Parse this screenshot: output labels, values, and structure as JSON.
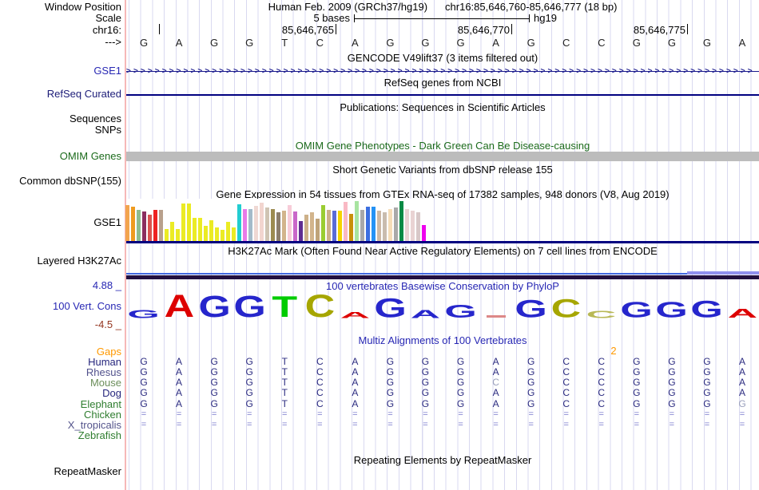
{
  "header": {
    "window_position_label": "Window Position",
    "assembly_line": "Human Feb. 2009 (GRCh37/hg19)",
    "position_line": "chr16:85,646,760-85,646,777 (18 bp)",
    "scale_label": "Scale",
    "scale_value": "5 bases",
    "assembly_short": "hg19",
    "chrom_label": "chr16:",
    "ruler": [
      {
        "text": "",
        "tick_x": 199
      },
      {
        "text": "85,646,765",
        "tick_x": 420
      },
      {
        "text": "85,646,770",
        "tick_x": 640
      },
      {
        "text": "85,646,775",
        "tick_x": 860
      }
    ],
    "strand_label": "--->",
    "sequence": "GAGGTCAGGGAGCCGGGA"
  },
  "tracks": {
    "gencode": {
      "title": "GENCODE V49lift37 (3 items filtered out)",
      "gene_label": "GSE1",
      "arrow_char": ">",
      "arrow_count": 88
    },
    "refseq": {
      "title": "RefSeq genes from NCBI",
      "label": "RefSeq Curated"
    },
    "publications": {
      "title": "Publications: Sequences in Scientific Articles",
      "label_sequences": "Sequences",
      "label_snps": "SNPs"
    },
    "omim": {
      "title": "OMIM Gene Phenotypes - Dark Green Can Be Disease-causing",
      "label": "OMIM Genes",
      "bar_color": "#bcbcbc"
    },
    "dbsnp": {
      "title": "Short Genetic Variants from dbSNP release 155",
      "label": "Common dbSNP(155)"
    },
    "gtex": {
      "title": "Gene Expression in 54 tissues from GTEx RNA-seq of 17382 samples, 948 donors (V8, Aug 2019)",
      "label": "GSE1",
      "baseline_color": "#000080",
      "bars": [
        [
          "#f2a44e",
          45
        ],
        [
          "#ef9b20",
          43
        ],
        [
          "#8fbc8f",
          39
        ],
        [
          "#8b2e5f",
          37
        ],
        [
          "#d9534f",
          33
        ],
        [
          "#ee2222",
          39
        ],
        [
          "#b8a08c",
          39
        ],
        [
          "#ebeb24",
          15
        ],
        [
          "#ebeb24",
          24
        ],
        [
          "#ebeb24",
          15
        ],
        [
          "#ebeb24",
          47
        ],
        [
          "#ebeb24",
          47
        ],
        [
          "#ebeb24",
          29
        ],
        [
          "#ebeb24",
          29
        ],
        [
          "#ebeb24",
          19
        ],
        [
          "#ebeb24",
          26
        ],
        [
          "#ebeb24",
          17
        ],
        [
          "#ebeb24",
          14
        ],
        [
          "#ebeb24",
          24
        ],
        [
          "#ebeb24",
          17
        ],
        [
          "#22cdd1",
          46
        ],
        [
          "#e87ae8",
          40
        ],
        [
          "#a3bac9",
          40
        ],
        [
          "#efd8d3",
          44
        ],
        [
          "#f2d5cf",
          48
        ],
        [
          "#cfc4b3",
          42
        ],
        [
          "#9c8b50",
          40
        ],
        [
          "#8b7d6b",
          36
        ],
        [
          "#d2b48c",
          38
        ],
        [
          "#f7ccd8",
          45
        ],
        [
          "#c967c9",
          37
        ],
        [
          "#5f2d91",
          25
        ],
        [
          "#cdb189",
          33
        ],
        [
          "#d2b48c",
          36
        ],
        [
          "#bfa379",
          28
        ],
        [
          "#9acd32",
          45
        ],
        [
          "#cdb189",
          39
        ],
        [
          "#5a6bd6",
          38
        ],
        [
          "#f5d300",
          38
        ],
        [
          "#f9b9c4",
          49
        ],
        [
          "#c8900b",
          34
        ],
        [
          "#a8e4a0",
          50
        ],
        [
          "#a9a9a9",
          39
        ],
        [
          "#3c6fe0",
          43
        ],
        [
          "#2492f5",
          43
        ],
        [
          "#cdb9a5",
          38
        ],
        [
          "#c9bcae",
          36
        ],
        [
          "#f5ddb8",
          40
        ],
        [
          "#a9a9a9",
          42
        ],
        [
          "#0a8a45",
          50
        ],
        [
          "#e9d3d3",
          40
        ],
        [
          "#e9d3d3",
          38
        ],
        [
          "#d8c8c8",
          36
        ],
        [
          "#ee00ee",
          20
        ]
      ]
    },
    "h3k27ac": {
      "title": "H3K27Ac Mark (Often Found Near Active Regulatory Elements) on 7 cell lines from ENCODE",
      "label": "Layered H3K27Ac",
      "line_color": "#4169e1",
      "peak_color": "#9090ee",
      "base_color": "#221040"
    },
    "conservation": {
      "title": "100 vertebrates Basewise Conservation by PhyloP",
      "label": "100 Vert. Cons",
      "max_label": "4.88 _",
      "min_label": "-4.5 _",
      "logo": [
        [
          "G",
          "#2626cc",
          0.36
        ],
        [
          "A",
          "#dd0000",
          1.0
        ],
        [
          "G",
          "#2626cc",
          0.95
        ],
        [
          "G",
          "#2626cc",
          0.95
        ],
        [
          "T",
          "#00cc00",
          0.92
        ],
        [
          "C",
          "#a6a600",
          1.0
        ],
        [
          "A",
          "#dd0000",
          0.28
        ],
        [
          "G",
          "#2626cc",
          0.85
        ],
        [
          "a",
          "#2626cc",
          0.36
        ],
        [
          "G",
          "#2626cc",
          0.58
        ],
        [
          "-",
          "#dd8888",
          0.1
        ],
        [
          "G",
          "#2626cc",
          0.78
        ],
        [
          "C",
          "#a6a600",
          0.82
        ],
        [
          "c",
          "#b8b855",
          0.33
        ],
        [
          "G",
          "#2626cc",
          0.7
        ],
        [
          "G",
          "#2626cc",
          0.7
        ],
        [
          "G",
          "#2626cc",
          0.75
        ],
        [
          "A",
          "#dd0000",
          0.4
        ]
      ]
    },
    "multiz": {
      "title": "Multiz Alignments of 100 Vertebrates",
      "gaps_label": "Gaps",
      "gap_count": "2",
      "base_color": "#2b2b80",
      "light_base_color": "#9aa0bc",
      "gap_glyph_color": "#7878cc",
      "rows": [
        {
          "name": "Human",
          "name_color": "#26267d",
          "bases": "GAGGTCAGGGAGCCGGGA",
          "light_indices": []
        },
        {
          "name": "Rhesus",
          "name_color": "#50508c",
          "bases": "GAGGTCAGGGAGCCGGGA",
          "light_indices": []
        },
        {
          "name": "Mouse",
          "name_color": "#6b8e5a",
          "bases": "GAGGTCAGGGCGCCGGGA",
          "light_indices": [
            10
          ]
        },
        {
          "name": "Dog",
          "name_color": "#26267d",
          "bases": "GAGGTCAGGGAGCCGGGA",
          "light_indices": []
        },
        {
          "name": "Elephant",
          "name_color": "#2f7d2f",
          "bases": "GAGGTCAGGGAGCCGGGG",
          "light_indices": [
            17
          ]
        },
        {
          "name": "Chicken",
          "name_color": "#2f7d2f",
          "bases": "==================",
          "light_indices": []
        },
        {
          "name": "X_tropicalis",
          "name_color": "#55558c",
          "bases": "==================",
          "light_indices": []
        },
        {
          "name": "Zebrafish",
          "name_color": "#2f7d2f",
          "bases": "",
          "light_indices": []
        }
      ]
    },
    "repeatmasker": {
      "title": "Repeating Elements by RepeatMasker",
      "label": "RepeatMasker"
    }
  }
}
